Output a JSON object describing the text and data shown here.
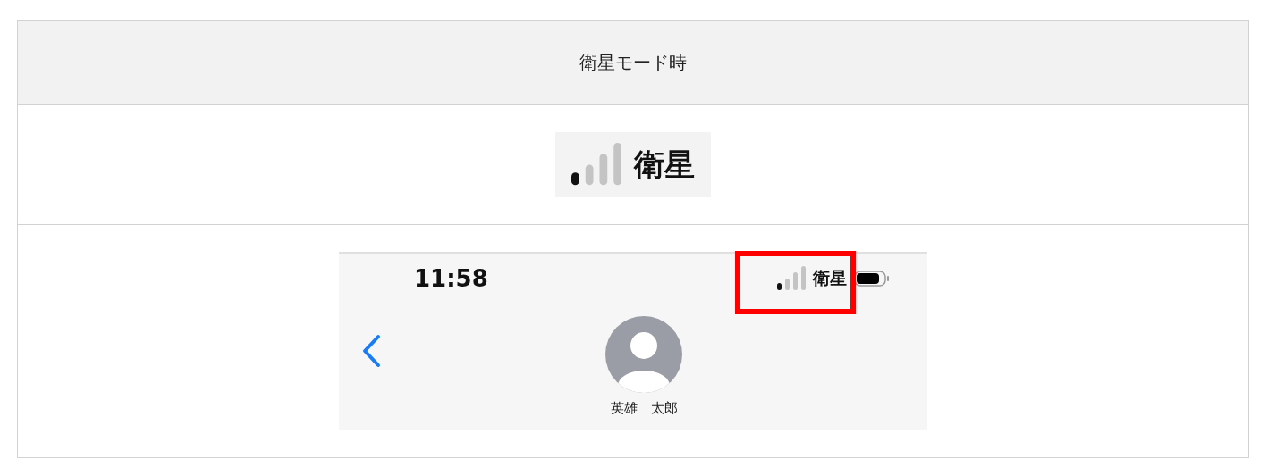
{
  "table": {
    "header": "衛星モード時",
    "icon_example": {
      "label": "衛星"
    },
    "screenshot": {
      "time": "11:58",
      "status_label": "衛星",
      "contact_name": "英雄　太郎",
      "highlighted": true
    }
  }
}
